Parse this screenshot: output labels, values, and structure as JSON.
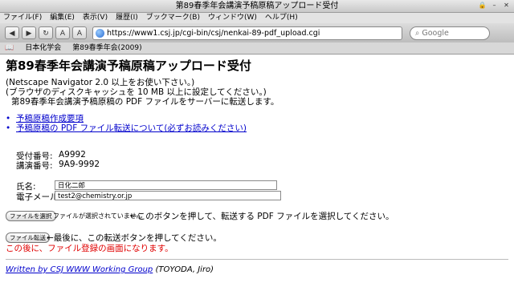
{
  "window": {
    "title": "第89春季年会講演予稿原稿アップロード受付"
  },
  "menu": [
    "ファイル(F)",
    "編集(E)",
    "表示(V)",
    "履歴(I)",
    "ブックマーク(B)",
    "ウィンドウ(W)",
    "ヘルプ(H)"
  ],
  "toolbar": {
    "url": "https://www1.csj.jp/cgi-bin/csj/nenkai-89-pdf_upload.cgi",
    "search_placeholder": "Google"
  },
  "bookmarks": [
    "日本化学会",
    "第89春季年会(2009)"
  ],
  "page": {
    "heading": "第89春季年会講演予稿原稿アップロード受付",
    "intro": [
      "(Netscape Navigator 2.0 以上をお使い下さい。)",
      "(ブラウザのディスクキャッシュを 10 MB 以上に設定してください。)",
      "第89春季年会講演予稿原稿の PDF ファイルをサーバーに転送します。"
    ],
    "links": [
      "予稿原稿作成要項",
      "予稿原稿の PDF ファイル転送について(必ずお読みください)"
    ],
    "receipt_label": "受付番号:",
    "receipt_value": "A9992",
    "talk_label": "講演番号:",
    "talk_value": "9A9-9992",
    "name_label": "氏名:",
    "name_value": "日化二郎",
    "email_label": "電子メール:",
    "email_value": "test2@chemistry.or.jp",
    "choose_file_button": "ファイルを選択",
    "no_file_text": "ファイルが選択されていません",
    "choose_hint": "←このボタンを押して、転送する PDF ファイルを選択してください。",
    "transfer_button": "ファイル転送",
    "transfer_hint": "←最後に、この転送ボタンを押してください。",
    "after_notice": "この後に、ファイル登録の画面になります。",
    "footer_link": "Written by CSJ WWW Working Group",
    "footer_rest": " (TOYODA, Jiro)"
  }
}
